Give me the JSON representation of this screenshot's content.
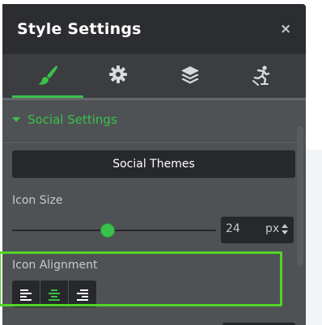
{
  "panel": {
    "title": "Style Settings",
    "close_symbol": "×"
  },
  "tabs": [
    {
      "icon": "brush-icon",
      "active": true
    },
    {
      "icon": "gear-icon",
      "active": false
    },
    {
      "icon": "layers-icon",
      "active": false
    },
    {
      "icon": "person-skating-icon",
      "active": false
    }
  ],
  "section": {
    "label": "Social Settings",
    "expanded": true
  },
  "social_themes": {
    "label": "Social Themes"
  },
  "icon_size": {
    "label": "Icon Size",
    "value": "24",
    "unit": "px"
  },
  "icon_alignment": {
    "label": "Icon Alignment",
    "options": [
      "align-left-icon",
      "align-center-icon",
      "align-right-icon"
    ],
    "selected": "align-center-icon"
  },
  "colors": {
    "accent": "#39c14a",
    "highlight": "#53d427",
    "panel_bg": "#4f5254",
    "header_bg": "#2c2d30",
    "control_bg": "#27282b"
  }
}
